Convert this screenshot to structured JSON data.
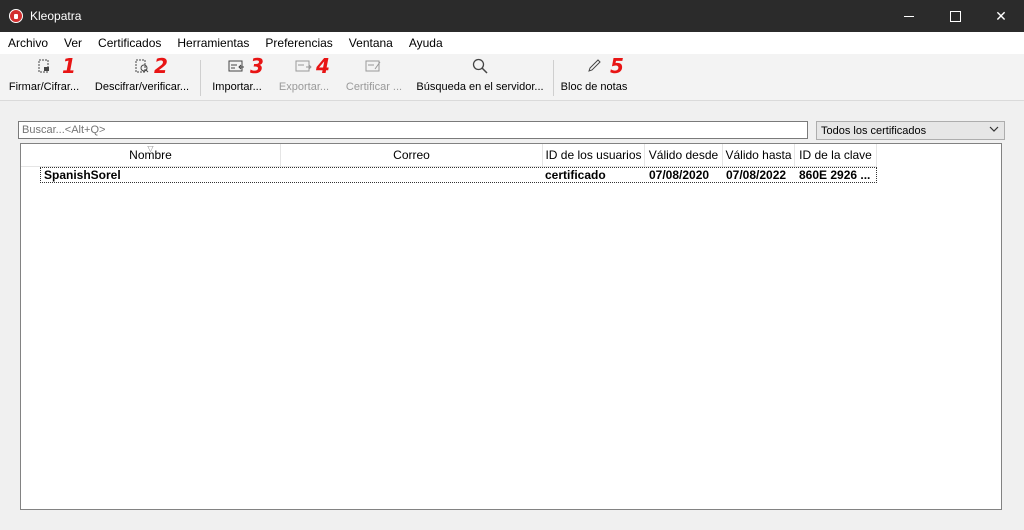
{
  "window": {
    "title": "Kleopatra"
  },
  "menu": [
    "Archivo",
    "Ver",
    "Certificados",
    "Herramientas",
    "Preferencias",
    "Ventana",
    "Ayuda"
  ],
  "toolbar": {
    "items": [
      {
        "label": "Firmar/Cifrar...",
        "icon": "sign-encrypt-icon",
        "enabled": true
      },
      {
        "label": "Descifrar/verificar...",
        "icon": "decrypt-verify-icon",
        "enabled": true
      },
      {
        "label": "Importar...",
        "icon": "import-icon",
        "enabled": true
      },
      {
        "label": "Exportar...",
        "icon": "export-icon",
        "enabled": false
      },
      {
        "label": "Certificar ...",
        "icon": "certify-icon",
        "enabled": false
      },
      {
        "label": "Búsqueda en el servidor...",
        "icon": "search-icon",
        "enabled": true
      },
      {
        "label": "Bloc de notas",
        "icon": "pencil-icon",
        "enabled": true
      }
    ],
    "annotations": [
      "1",
      "2",
      "3",
      "4",
      "5"
    ]
  },
  "search": {
    "placeholder": "Buscar...<Alt+Q>"
  },
  "filter": {
    "selected": "Todos los certificados"
  },
  "table": {
    "columns": [
      "Nombre",
      "Correo",
      "ID de los usuarios",
      "Válido desde",
      "Válido hasta",
      "ID de la clave"
    ],
    "rows": [
      {
        "name": "SpanishSorel",
        "email": "",
        "user_ids": "certificado",
        "valid_from": "07/08/2020",
        "valid_until": "07/08/2022",
        "key_id": "860E 2926 ..."
      }
    ]
  },
  "colors": {
    "titlebar": "#2b2b2b",
    "annotation": "#e81414"
  }
}
